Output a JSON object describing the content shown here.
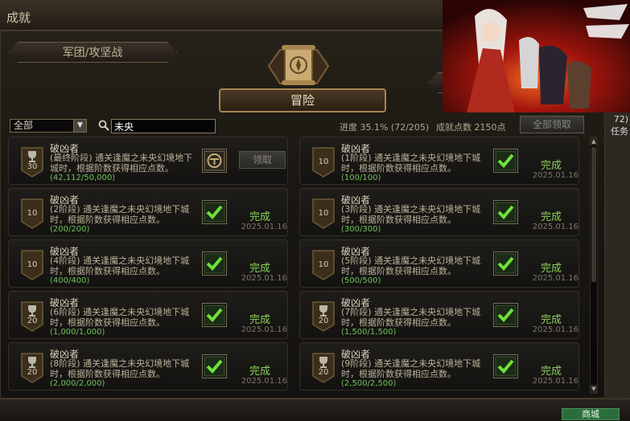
{
  "window": {
    "title": "成就"
  },
  "tabs": {
    "guild_tab": "军团/攻坚战",
    "adventure_tab": "冒险"
  },
  "toolbar": {
    "filter_value": "全部",
    "search_value": "未央",
    "progress_text": "进度  35.1%  (72/205)",
    "points_text": "成就点数  2150点",
    "claim_all_label": "全部领取"
  },
  "achievements": [
    {
      "name": "破凶者",
      "desc": "(最终阶段) 通关逢魔之未央幻境地下城时，根据阶数获得相应点数。",
      "count": "(42,112/50,000)",
      "points": "30",
      "status": "",
      "date": "",
      "claim": "领取",
      "trophy": true
    },
    {
      "name": "破凶者",
      "desc": "(1阶段) 通关逢魔之未央幻境地下城时，根据阶数获得相应点数。",
      "count": "(100/100)",
      "points": "10",
      "status": "完成",
      "date": "2025.01.16",
      "claim": "",
      "trophy": false
    },
    {
      "name": "破凶者",
      "desc": "(2阶段) 通关逢魔之未央幻境地下城时，根据阶数获得相应点数。",
      "count": "(200/200)",
      "points": "10",
      "status": "完成",
      "date": "2025.01.16",
      "claim": "",
      "trophy": false
    },
    {
      "name": "破凶者",
      "desc": "(3阶段) 通关逢魔之未央幻境地下城时，根据阶数获得相应点数。",
      "count": "(300/300)",
      "points": "10",
      "status": "完成",
      "date": "2025.01.16",
      "claim": "",
      "trophy": false
    },
    {
      "name": "破凶者",
      "desc": "(4阶段) 通关逢魔之未央幻境地下城时，根据阶数获得相应点数。",
      "count": "(400/400)",
      "points": "10",
      "status": "完成",
      "date": "2025.01.16",
      "claim": "",
      "trophy": false
    },
    {
      "name": "破凶者",
      "desc": "(5阶段) 通关逢魔之未央幻境地下城时，根据阶数获得相应点数。",
      "count": "(500/500)",
      "points": "10",
      "status": "完成",
      "date": "2025.01.16",
      "claim": "",
      "trophy": false
    },
    {
      "name": "破凶者",
      "desc": "(6阶段) 通关逢魔之未央幻境地下城时，根据阶数获得相应点数。",
      "count": "(1,000/1,000)",
      "points": "20",
      "status": "完成",
      "date": "2025.01.16",
      "claim": "",
      "trophy": true
    },
    {
      "name": "破凶者",
      "desc": "(7阶段) 通关逢魔之未央幻境地下城时，根据阶数获得相应点数。",
      "count": "(1,500/1,500)",
      "points": "20",
      "status": "完成",
      "date": "2025.01.16",
      "claim": "",
      "trophy": true
    },
    {
      "name": "破凶者",
      "desc": "(8阶段) 通关逢魔之未央幻境地下城时，根据阶数获得相应点数。",
      "count": "(2,000/2,000)",
      "points": "20",
      "status": "完成",
      "date": "2025.01.16",
      "claim": "",
      "trophy": true
    },
    {
      "name": "破凶者",
      "desc": "(9阶段) 通关逢魔之未央幻境地下城时，根据阶数获得相应点数。",
      "count": "(2,500/2,500)",
      "points": "20",
      "status": "完成",
      "date": "2025.01.16",
      "claim": "",
      "trophy": true
    }
  ],
  "sidebar": {
    "text_1": "72)",
    "text_2": "任务"
  },
  "bottombar": {
    "shop_label": "商城"
  },
  "colors": {
    "complete_green": "#8ad15a",
    "count_green": "#6fc35c",
    "gold_border": "#a48554"
  },
  "icons": {
    "check": "check-icon",
    "trophy": "trophy-icon",
    "search": "search-icon",
    "reward_box": "reward-box-icon"
  }
}
